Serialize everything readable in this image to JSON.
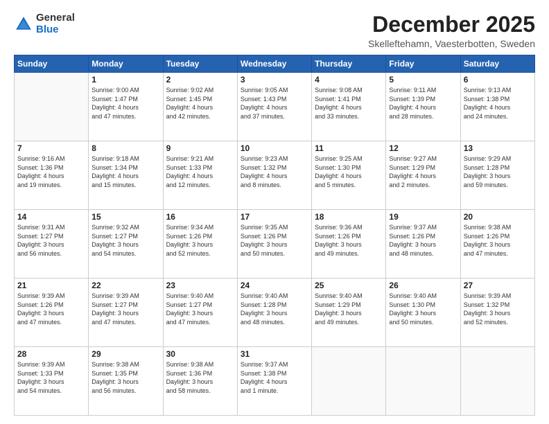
{
  "logo": {
    "general": "General",
    "blue": "Blue"
  },
  "title": "December 2025",
  "location": "Skelleftehamn, Vaesterbotten, Sweden",
  "weekdays": [
    "Sunday",
    "Monday",
    "Tuesday",
    "Wednesday",
    "Thursday",
    "Friday",
    "Saturday"
  ],
  "weeks": [
    [
      {
        "day": "",
        "info": ""
      },
      {
        "day": "1",
        "info": "Sunrise: 9:00 AM\nSunset: 1:47 PM\nDaylight: 4 hours\nand 47 minutes."
      },
      {
        "day": "2",
        "info": "Sunrise: 9:02 AM\nSunset: 1:45 PM\nDaylight: 4 hours\nand 42 minutes."
      },
      {
        "day": "3",
        "info": "Sunrise: 9:05 AM\nSunset: 1:43 PM\nDaylight: 4 hours\nand 37 minutes."
      },
      {
        "day": "4",
        "info": "Sunrise: 9:08 AM\nSunset: 1:41 PM\nDaylight: 4 hours\nand 33 minutes."
      },
      {
        "day": "5",
        "info": "Sunrise: 9:11 AM\nSunset: 1:39 PM\nDaylight: 4 hours\nand 28 minutes."
      },
      {
        "day": "6",
        "info": "Sunrise: 9:13 AM\nSunset: 1:38 PM\nDaylight: 4 hours\nand 24 minutes."
      }
    ],
    [
      {
        "day": "7",
        "info": "Sunrise: 9:16 AM\nSunset: 1:36 PM\nDaylight: 4 hours\nand 19 minutes."
      },
      {
        "day": "8",
        "info": "Sunrise: 9:18 AM\nSunset: 1:34 PM\nDaylight: 4 hours\nand 15 minutes."
      },
      {
        "day": "9",
        "info": "Sunrise: 9:21 AM\nSunset: 1:33 PM\nDaylight: 4 hours\nand 12 minutes."
      },
      {
        "day": "10",
        "info": "Sunrise: 9:23 AM\nSunset: 1:32 PM\nDaylight: 4 hours\nand 8 minutes."
      },
      {
        "day": "11",
        "info": "Sunrise: 9:25 AM\nSunset: 1:30 PM\nDaylight: 4 hours\nand 5 minutes."
      },
      {
        "day": "12",
        "info": "Sunrise: 9:27 AM\nSunset: 1:29 PM\nDaylight: 4 hours\nand 2 minutes."
      },
      {
        "day": "13",
        "info": "Sunrise: 9:29 AM\nSunset: 1:28 PM\nDaylight: 3 hours\nand 59 minutes."
      }
    ],
    [
      {
        "day": "14",
        "info": "Sunrise: 9:31 AM\nSunset: 1:27 PM\nDaylight: 3 hours\nand 56 minutes."
      },
      {
        "day": "15",
        "info": "Sunrise: 9:32 AM\nSunset: 1:27 PM\nDaylight: 3 hours\nand 54 minutes."
      },
      {
        "day": "16",
        "info": "Sunrise: 9:34 AM\nSunset: 1:26 PM\nDaylight: 3 hours\nand 52 minutes."
      },
      {
        "day": "17",
        "info": "Sunrise: 9:35 AM\nSunset: 1:26 PM\nDaylight: 3 hours\nand 50 minutes."
      },
      {
        "day": "18",
        "info": "Sunrise: 9:36 AM\nSunset: 1:26 PM\nDaylight: 3 hours\nand 49 minutes."
      },
      {
        "day": "19",
        "info": "Sunrise: 9:37 AM\nSunset: 1:26 PM\nDaylight: 3 hours\nand 48 minutes."
      },
      {
        "day": "20",
        "info": "Sunrise: 9:38 AM\nSunset: 1:26 PM\nDaylight: 3 hours\nand 47 minutes."
      }
    ],
    [
      {
        "day": "21",
        "info": "Sunrise: 9:39 AM\nSunset: 1:26 PM\nDaylight: 3 hours\nand 47 minutes."
      },
      {
        "day": "22",
        "info": "Sunrise: 9:39 AM\nSunset: 1:27 PM\nDaylight: 3 hours\nand 47 minutes."
      },
      {
        "day": "23",
        "info": "Sunrise: 9:40 AM\nSunset: 1:27 PM\nDaylight: 3 hours\nand 47 minutes."
      },
      {
        "day": "24",
        "info": "Sunrise: 9:40 AM\nSunset: 1:28 PM\nDaylight: 3 hours\nand 48 minutes."
      },
      {
        "day": "25",
        "info": "Sunrise: 9:40 AM\nSunset: 1:29 PM\nDaylight: 3 hours\nand 49 minutes."
      },
      {
        "day": "26",
        "info": "Sunrise: 9:40 AM\nSunset: 1:30 PM\nDaylight: 3 hours\nand 50 minutes."
      },
      {
        "day": "27",
        "info": "Sunrise: 9:39 AM\nSunset: 1:32 PM\nDaylight: 3 hours\nand 52 minutes."
      }
    ],
    [
      {
        "day": "28",
        "info": "Sunrise: 9:39 AM\nSunset: 1:33 PM\nDaylight: 3 hours\nand 54 minutes."
      },
      {
        "day": "29",
        "info": "Sunrise: 9:38 AM\nSunset: 1:35 PM\nDaylight: 3 hours\nand 56 minutes."
      },
      {
        "day": "30",
        "info": "Sunrise: 9:38 AM\nSunset: 1:36 PM\nDaylight: 3 hours\nand 58 minutes."
      },
      {
        "day": "31",
        "info": "Sunrise: 9:37 AM\nSunset: 1:38 PM\nDaylight: 4 hours\nand 1 minute."
      },
      {
        "day": "",
        "info": ""
      },
      {
        "day": "",
        "info": ""
      },
      {
        "day": "",
        "info": ""
      }
    ]
  ]
}
